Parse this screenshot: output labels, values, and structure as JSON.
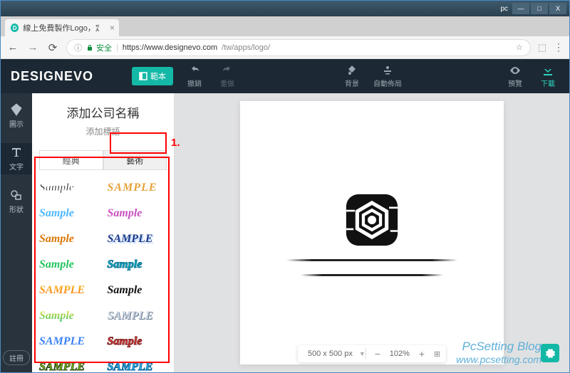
{
  "window": {
    "title": "pc",
    "btns": [
      "—",
      "□",
      "X"
    ]
  },
  "tab": {
    "title": "線上免費製作Logo，定",
    "favicon": "D"
  },
  "addr": {
    "secure_label": "安全",
    "host": "https://www.designevo.com",
    "path": "/tw/apps/logo/"
  },
  "topbar": {
    "logo": "DESIGNEVO",
    "template": "範本",
    "undo": "撤銷",
    "redo": "重做",
    "bg": "背景",
    "layout": "自動佈局",
    "preview": "預覽",
    "download": "下載"
  },
  "rail": {
    "icons": "圖示",
    "text": "文字",
    "shape": "形狀",
    "register": "註冊"
  },
  "panel": {
    "title": "添加公司名稱",
    "subtitle": "添加標語",
    "tab_classic": "經典",
    "tab_art": "藝術"
  },
  "samples": [
    {
      "t": "Sample",
      "css": "color:#222;font-family:Arial Black;-webkit-text-stroke:1px #fff"
    },
    {
      "t": "SAMPLE",
      "css": "color:#e6a23c;font-family:Georgia;letter-spacing:1px"
    },
    {
      "t": "Sample",
      "css": "color:#4db8ff;font-family:cursive;font-style:italic"
    },
    {
      "t": "Sample",
      "css": "color:#c850c0;font-family:cursive;font-style:italic;font-weight:900"
    },
    {
      "t": "Sample",
      "css": "color:#d97706;font-family:cursive;font-style:italic"
    },
    {
      "t": "SAMPLE",
      "css": "color:#1e3a8a;font-family:Impact;text-shadow:2px 2px 0 #bfdbfe"
    },
    {
      "t": "Sample",
      "css": "color:#22c55e;font-family:Arial Black"
    },
    {
      "t": "Sample",
      "css": "color:#06b6d4;font-family:Arial Black;-webkit-text-stroke:1px #0e7490"
    },
    {
      "t": "SAMPLE",
      "css": "background:linear-gradient(#fbbf24,#f97316);-webkit-background-clip:text;color:transparent;font-family:Impact"
    },
    {
      "t": "Sample",
      "css": "color:#111;font-family:cursive;font-style:italic"
    },
    {
      "t": "Sample",
      "css": "background:linear-gradient(#fde047,#22c55e);-webkit-background-clip:text;color:transparent;font-family:Arial Black;font-style:italic"
    },
    {
      "t": "SAMPLE",
      "css": "color:#cbd5e1;font-family:Impact;text-shadow:1px 1px 0 #64748b"
    },
    {
      "t": "SAMPLE",
      "css": "color:#3b82f6;font-family:Impact;font-style:italic"
    },
    {
      "t": "Sample",
      "css": "color:#ef4444;font-family:Arial Black;font-style:italic;-webkit-text-stroke:1px #7f1d1d"
    },
    {
      "t": "SAMPLE",
      "css": "color:#84cc16;font-family:Impact;-webkit-text-stroke:1px #365314"
    },
    {
      "t": "SAMPLE",
      "css": "color:#38bdf8;font-family:Impact;-webkit-text-stroke:1px #0369a1"
    }
  ],
  "zoom": {
    "size": "500 x 500 px",
    "level": "102%"
  },
  "annotation": {
    "label": "1."
  },
  "watermark": {
    "line1": "PcSetting Blog",
    "line2": "www.pcsetting.com"
  }
}
